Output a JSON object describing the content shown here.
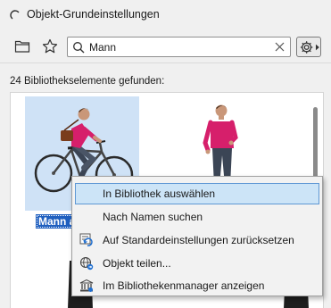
{
  "window": {
    "title": "Objekt-Grundeinstellungen"
  },
  "toolbar": {
    "folder_icon": "folder-icon",
    "favorites_icon": "star-icon",
    "settings_icon": "gear-icon"
  },
  "search": {
    "value": "Mann",
    "placeholder": ""
  },
  "results": {
    "count_text": "24 Bibliothekselemente gefunden:",
    "items": [
      {
        "label": "Mann a",
        "selected": true,
        "thumbnail": "man-on-bicycle"
      },
      {
        "label": "",
        "selected": false,
        "thumbnail": "standing-man"
      }
    ]
  },
  "context_menu": {
    "items": [
      {
        "label": "In Bibliothek auswählen",
        "icon": "",
        "highlighted": true
      },
      {
        "label": "Nach Namen suchen",
        "icon": "",
        "highlighted": false
      },
      {
        "label": "Auf Standardeinstellungen zurücksetzen",
        "icon": "reset-icon",
        "highlighted": false
      },
      {
        "label": "Objekt teilen...",
        "icon": "share-globe-icon",
        "highlighted": false
      },
      {
        "label": "Im Bibliothekenmanager anzeigen",
        "icon": "library-manager-icon",
        "highlighted": false
      }
    ]
  },
  "colors": {
    "selection": "#1f5fbf",
    "thumbnail_highlight": "#cfe2f6",
    "menu_highlight": "#cce4f7",
    "shirt": "#d61f6b"
  }
}
